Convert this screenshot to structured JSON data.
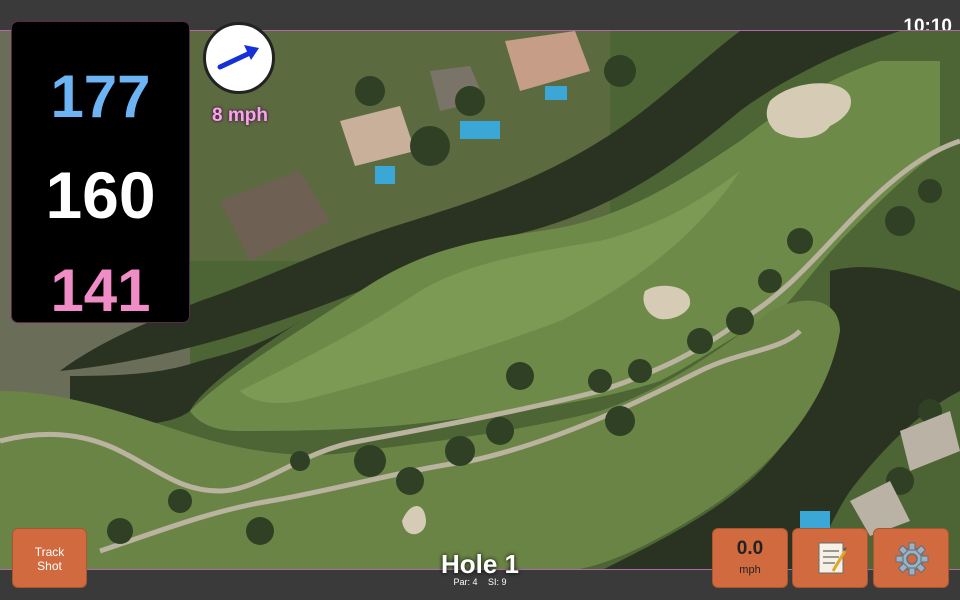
{
  "status": {
    "time": "10:10"
  },
  "yardage": {
    "back": "177",
    "middle": "160",
    "front": "141"
  },
  "wind": {
    "speed_label": "8 mph",
    "icon": "arrow-right-icon"
  },
  "hole": {
    "title": "Hole 1",
    "par": "Par: 4",
    "stroke_index": "SI: 9"
  },
  "buttons": {
    "track_shot_line1": "Track",
    "track_shot_line2": "Shot",
    "speed_value": "0.0",
    "speed_unit": "mph",
    "notes_icon": "notepad-icon",
    "settings_icon": "gear-icon"
  },
  "colors": {
    "back": "#6cb4f4",
    "middle": "#ffffff",
    "front": "#f08cc6",
    "button": "#d16b3f",
    "wind_label": "#f5a8e6"
  }
}
